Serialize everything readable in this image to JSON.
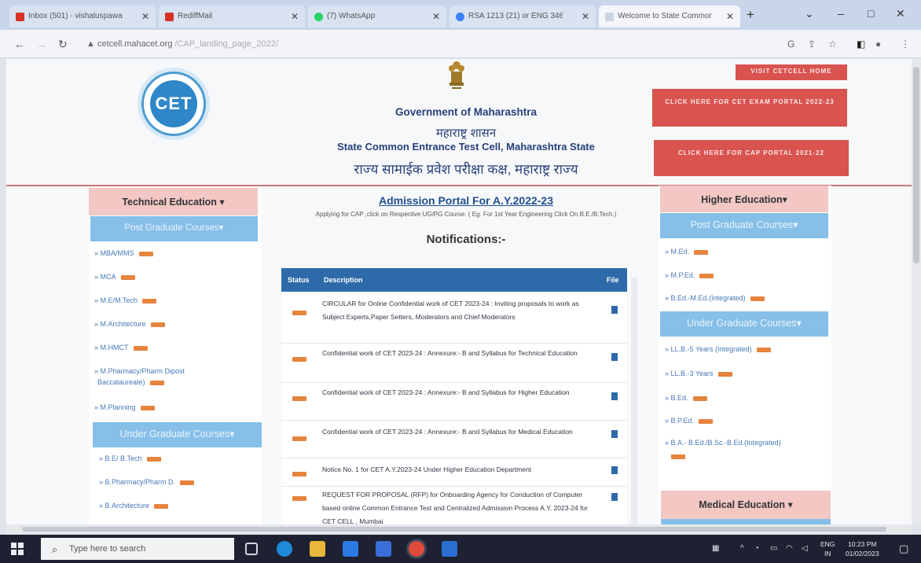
{
  "browser": {
    "tabs": [
      {
        "title": "Inbox (501) - vishaluspawar",
        "fav": "#d93025"
      },
      {
        "title": "RediffMail",
        "fav": "#d93025"
      },
      {
        "title": "(7) WhatsApp",
        "fav": "#25d366"
      },
      {
        "title": "RSA 1213 (21) or ENG 346",
        "fav": "#3b82f6"
      },
      {
        "title": "Welcome to State Common",
        "fav": "#cbd5e1"
      }
    ],
    "new_tab": "+",
    "url_domain": "cetcell.mahacet.org",
    "url_path": "/CAP_landing_page_2022/",
    "controls": {
      "minimize": "–",
      "maximize": "□",
      "close": "✕",
      "dropdown": "⌄"
    }
  },
  "header": {
    "logo_text": "CET",
    "gov_title": "Government of Maharashtra",
    "gov_marathi": "महाराष्ट्र शासन",
    "cell_title": "State Common Entrance Test Cell, Maharashtra State",
    "cell_marathi": "राज्य सामाईक प्रवेश परीक्षा कक्ष, महाराष्ट्र राज्य",
    "btn_visit": "VISIT CETCELL HOME",
    "btn_exam_portal": "CLICK HERE FOR CET EXAM PORTAL 2022-23",
    "btn_cap_portal": "CLICK HERE FOR CAP PORTAL 2021-22"
  },
  "technical": {
    "title": "Technical Education ▾",
    "pg_title": "Post Graduate Courses▾",
    "pg_items": [
      "MBA/MMS",
      "MCA",
      "M.E/M.Tech",
      "M.Architecture",
      "M.HMCT",
      "M.Pharmacy/Pharm Dipost",
      "M.Planning"
    ],
    "pg_item_extra": "Baccalaureate)",
    "ug_title": "Under Graduate Courses▾",
    "ug_items": [
      "B.E/ B.Tech",
      "B.Pharmacy/Pharm D.",
      "B.Architecture"
    ]
  },
  "higher": {
    "title": "Higher Education▾",
    "pg_title": "Post Graduate Courses▾",
    "pg_items": [
      "M.Ed.",
      "M.P.Ed.",
      "B.Ed.-M.Ed.(Integrated)"
    ],
    "ug_title": "Under Graduate Courses▾",
    "ug_items": [
      "LL.B.-5 Years (Integrated)",
      "LL.B.-3 Years",
      "B.Ed.",
      "B.P.Ed.",
      "B.A.- B.Ed./B.Sc.-B.Ed.(Integrated)"
    ]
  },
  "medical": {
    "title": "Medical Education ▾"
  },
  "center": {
    "admission_title": "Admission Portal For A.Y.2022-23",
    "admission_sub": "Applying for CAP ,click on Respective UG/PG Course. ( Eg. For 1st Year Engineering Click On B.E./B.Tech.)",
    "notifications_title": "Notifications:-",
    "table_headers": {
      "status": "Status",
      "description": "Description",
      "file": "File"
    },
    "notifications": [
      "CIRCULAR for Online Confidential work of CET 2023-24 : Inviting proposals to work as Subject Experts,Paper Setters, Moderators and Chief Moderators",
      "Confidential work of CET 2023-24 : Annexure:- B and Syllabus for Technical Education",
      "Confidential work of CET 2023-24 : Annexure:- B and Syllabus for Higher Education",
      "Confidential work of CET 2023-24 : Annexure:- B and Syllabus for Medical Education",
      "Notice No. 1 for CET A.Y.2023-24 Under Higher Education Department",
      "REQUEST FOR PROPOSAL (RFP) for Onboarding Agency for Conduction of Computer based online Common Entrance Test and Centralized Admission Process A.Y. 2023-24 for CET CELL , Mumbai"
    ]
  },
  "taskbar": {
    "search_placeholder": "Type here to search",
    "lang_top": "ENG",
    "lang_bottom": "IN",
    "time": "10:23 PM",
    "date": "01/02/2023"
  },
  "colors": {
    "accent_red": "#d9534f",
    "blue_header": "#2e6aa9",
    "pink_header": "#f2c7c4",
    "light_blue": "#86bfe8",
    "new_badge": "#e6843e"
  }
}
